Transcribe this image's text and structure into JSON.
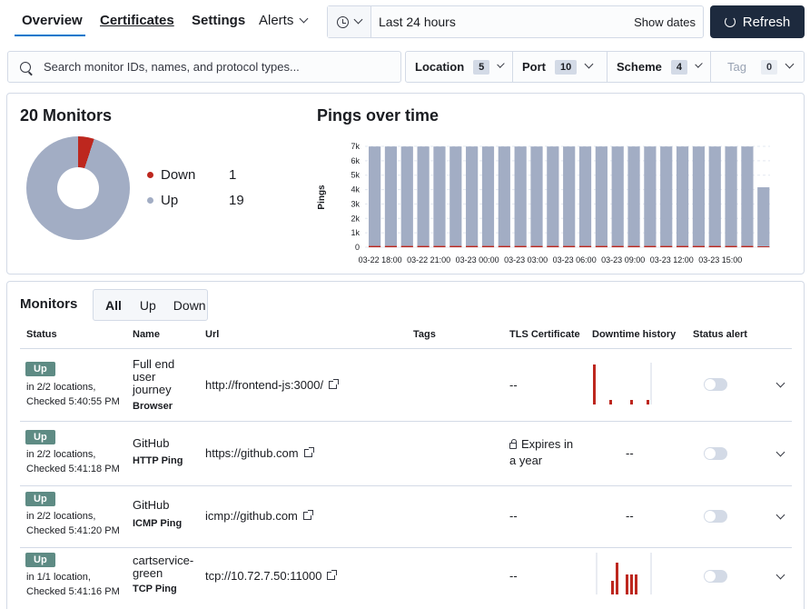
{
  "nav": {
    "tabs": [
      "Overview",
      "Certificates",
      "Settings"
    ],
    "alerts": "Alerts"
  },
  "datepicker": {
    "range": "Last 24 hours",
    "show_dates": "Show dates"
  },
  "refresh_label": "Refresh",
  "search": {
    "placeholder": "Search monitor IDs, names, and protocol types..."
  },
  "filters": [
    {
      "label": "Location",
      "count": "5"
    },
    {
      "label": "Port",
      "count": "10"
    },
    {
      "label": "Scheme",
      "count": "4"
    },
    {
      "label": "Tag",
      "count": "0"
    }
  ],
  "summary": {
    "title": "20 Monitors",
    "down_label": "Down",
    "down_count": "1",
    "up_label": "Up",
    "up_count": "19",
    "colors": {
      "down": "#bd271e",
      "up": "#a2adc4"
    }
  },
  "chart_data": {
    "type": "bar",
    "title": "Pings over time",
    "ylabel": "Pings",
    "ylim": [
      0,
      7000
    ],
    "yticks": [
      "0",
      "1k",
      "2k",
      "3k",
      "4k",
      "5k",
      "6k",
      "7k"
    ],
    "xticks": [
      "03-22 18:00",
      "03-22 21:00",
      "03-23 00:00",
      "03-23 03:00",
      "03-23 06:00",
      "03-23 09:00",
      "03-23 12:00",
      "03-23 15:00"
    ],
    "series": [
      {
        "name": "Up",
        "color": "#a2adc4",
        "values": [
          6900,
          6900,
          6900,
          6900,
          6900,
          6900,
          6900,
          6900,
          6900,
          6900,
          6900,
          6900,
          6900,
          6900,
          6900,
          6900,
          6900,
          6900,
          6900,
          6900,
          6900,
          6900,
          6900,
          6900,
          4100
        ]
      },
      {
        "name": "Down",
        "color": "#bd271e",
        "values": [
          90,
          90,
          90,
          90,
          90,
          90,
          90,
          90,
          90,
          90,
          90,
          90,
          90,
          90,
          90,
          90,
          90,
          90,
          90,
          90,
          90,
          90,
          90,
          90,
          60
        ]
      }
    ]
  },
  "monitors": {
    "title": "Monitors",
    "filter_tabs": [
      "All",
      "Up",
      "Down"
    ],
    "columns": [
      "Status",
      "Name",
      "Url",
      "Tags",
      "TLS Certificate",
      "Downtime history",
      "Status alert"
    ],
    "rows": [
      {
        "status": "Up",
        "locations": "in 2/2 locations,",
        "checked": "Checked 5:40:55 PM",
        "name": "Full end user journey",
        "type": "Browser",
        "url": "http://frontend-js:3000/",
        "tls": "--",
        "history": "--"
      },
      {
        "status": "Up",
        "locations": "in 2/2 locations,",
        "checked": "Checked 5:41:18 PM",
        "name": "GitHub",
        "type": "HTTP Ping",
        "url": "https://github.com",
        "tls": "Expires in a year",
        "history": "--"
      },
      {
        "status": "Up",
        "locations": "in 2/2 locations,",
        "checked": "Checked 5:41:20 PM",
        "name": "GitHub",
        "type": "ICMP Ping",
        "url": "icmp://github.com",
        "tls": "--",
        "history": "--"
      },
      {
        "status": "Up",
        "locations": "in 1/1 location,",
        "checked": "Checked 5:41:16 PM",
        "name": "cartservice-green",
        "type": "TCP Ping",
        "url": "tcp://10.72.7.50:11000",
        "tls": "--",
        "history": "--"
      }
    ]
  }
}
